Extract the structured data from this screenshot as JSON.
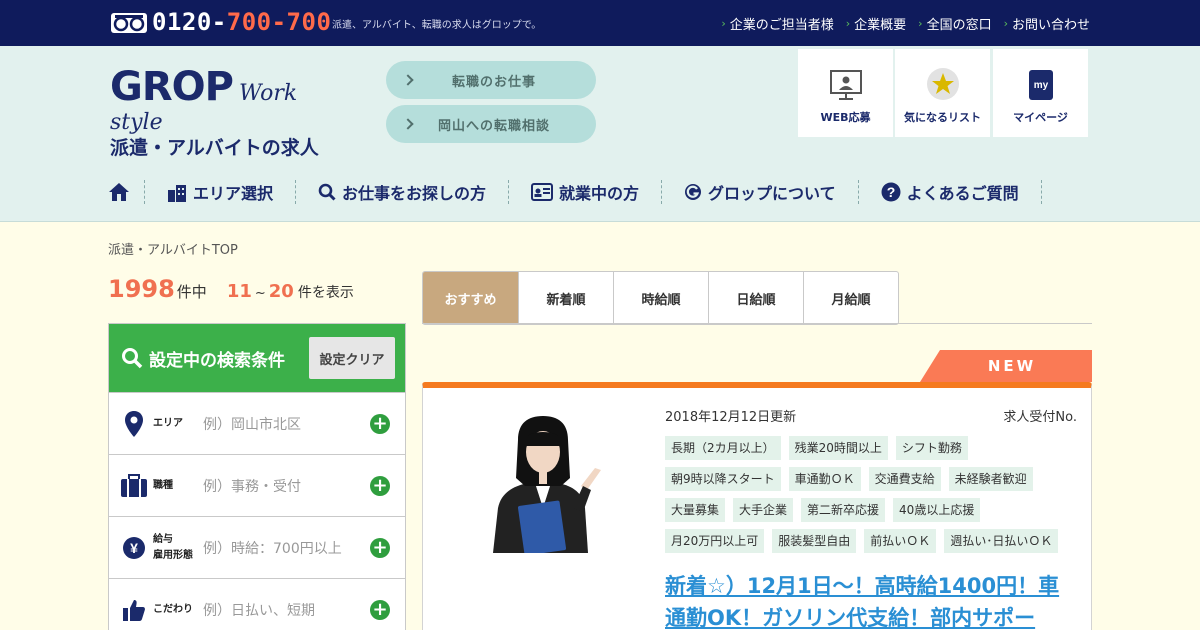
{
  "topbar": {
    "phone_prefix": "0120-",
    "phone_main": "700-700",
    "tagline": "派遣、アルバイト、転職の求人はグロップで。",
    "links": [
      "企業のご担当者様",
      "企業概要",
      "全国の窓口",
      "お問い合わせ"
    ]
  },
  "header": {
    "logo_brand": "GROP",
    "logo_workstyle": "Work style",
    "logo_sub": "派遣・アルバイトの求人",
    "pill_1": "転職のお仕事",
    "pill_2": "岡山への転職相談",
    "quick": [
      "WEB応募",
      "気になるリスト",
      "マイページ"
    ],
    "mypage_icon_text": "my"
  },
  "nav": {
    "items": [
      "エリア選択",
      "お仕事をお探しの方",
      "就業中の方",
      "グロップについて",
      "よくあるご質問"
    ]
  },
  "breadcrumb": "派遣・アルバイトTOP",
  "results": {
    "total": "1998",
    "total_unit": "件中",
    "range_start": "11",
    "range_sep": "~",
    "range_end": "20",
    "range_unit": "件を表示"
  },
  "sidebar": {
    "title": "設定中の検索条件",
    "clear_label": "設定クリア",
    "rows": [
      {
        "label": "エリア",
        "label2": "",
        "placeholder": "例）岡山市北区"
      },
      {
        "label": "職種",
        "label2": "",
        "placeholder": "例）事務・受付"
      },
      {
        "label": "給与",
        "label2": "雇用形態",
        "placeholder": "例）時給：700円以上"
      },
      {
        "label": "こだわり",
        "label2": "",
        "placeholder": "例）日払い、短期"
      }
    ]
  },
  "sort_tabs": [
    "おすすめ",
    "新着順",
    "時給順",
    "日給順",
    "月給順"
  ],
  "job": {
    "badge": "NEW",
    "updated": "2018年12月12日更新",
    "job_no_label": "求人受付No.",
    "tags": [
      "長期（2カ月以上）",
      "残業20時間以上",
      "シフト勤務",
      "朝9時以降スタート",
      "車通勤ＯＫ",
      "交通費支給",
      "未経験者歓迎",
      "大量募集",
      "大手企業",
      "第二新卒応援",
      "40歳以上応援",
      "月20万円以上可",
      "服装髪型自由",
      "前払いＯＫ",
      "週払い･日払いＯＫ"
    ],
    "title": "新着☆）12月1日～！高時給1400円！車通勤OK！ガソリン代支給！部内サポー"
  },
  "colors": {
    "topbar": "#0f1b5c",
    "accent_red": "#f07050",
    "green": "#3cb04a",
    "tab_active": "#c8a87f",
    "card_top": "#f57a1f",
    "link_blue": "#2a8fd4"
  }
}
